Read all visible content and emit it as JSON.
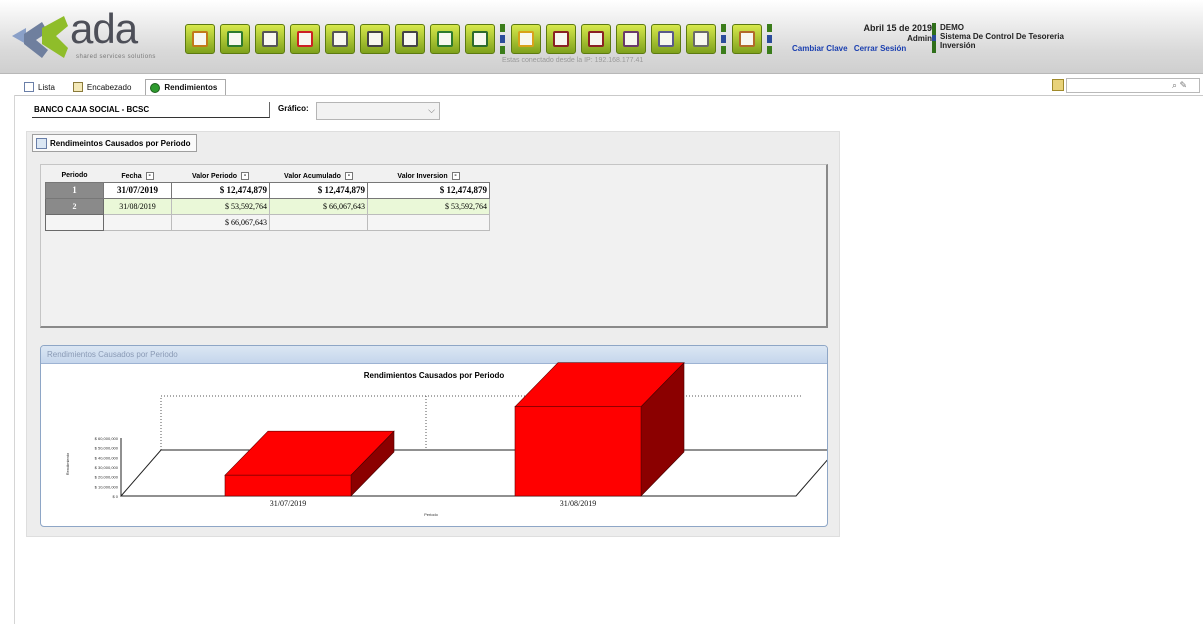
{
  "header": {
    "logo_text": "ada",
    "logo_subtitle": "shared services solutions",
    "connection_msg": "Estas conectado desde la IP: 192.168.177.41",
    "date": "Abril 15 de 2019",
    "user": "Admin",
    "links": [
      "Cambiar Clave",
      "Cerrar Sesión"
    ],
    "company": "DEMO",
    "system": "Sistema De Control De Tesoreria",
    "module": "Inversión",
    "toolbar_icons": [
      "folder-icon",
      "document-icon",
      "save-icon",
      "delete-icon",
      "undo-icon",
      "list-icon",
      "search-doc-icon",
      "export-icon",
      "truck-icon",
      "lock-icon",
      "camera-icon",
      "camera-icon",
      "grid-icon",
      "window-icon",
      "print-icon",
      "chart-icon"
    ]
  },
  "tabs": [
    {
      "label": "Lista",
      "icon": "list-icon"
    },
    {
      "label": "Encabezado",
      "icon": "clipboard-icon"
    },
    {
      "label": "Rendimientos",
      "icon": "money-icon",
      "active": true
    }
  ],
  "search": {
    "value": ""
  },
  "bank": "BANCO CAJA SOCIAL - BCSC",
  "grafico": {
    "label": "Gráfico:",
    "value": ""
  },
  "section_button": "Rendimeintos Causados por Periodo",
  "grid": {
    "headers": [
      "Periodo",
      "Fecha",
      "Valor Periodo",
      "Valor Acumulado",
      "Valor Inversion"
    ],
    "rows": [
      [
        "1",
        "31/07/2019",
        "$ 12,474,879",
        "$ 12,474,879",
        "$ 12,474,879"
      ],
      [
        "2",
        "31/08/2019",
        "$ 53,592,764",
        "$ 66,067,643",
        "$ 53,592,764"
      ]
    ],
    "total": "$ 66,067,643"
  },
  "chart_panel": {
    "header": "Rendimientos Causados por Periodo"
  },
  "chart_data": {
    "type": "bar",
    "title": "Rendimientos Causados por Periodo",
    "categories": [
      "31/07/2019",
      "31/08/2019"
    ],
    "values": [
      12474879,
      53592764
    ],
    "xlabel": "Periodo",
    "ylabel": "Rendimiento",
    "ytick_labels": [
      "$ 60,000,000",
      "$ 50,000,000",
      "$ 40,000,000",
      "$ 30,000,000",
      "$ 20,000,000",
      "$ 10,000,000",
      "$ 0"
    ],
    "ylim": [
      0,
      60000000
    ],
    "bar_color": "#ff0000",
    "bar_side_color": "#8b0000",
    "grid": false,
    "3d": true
  }
}
